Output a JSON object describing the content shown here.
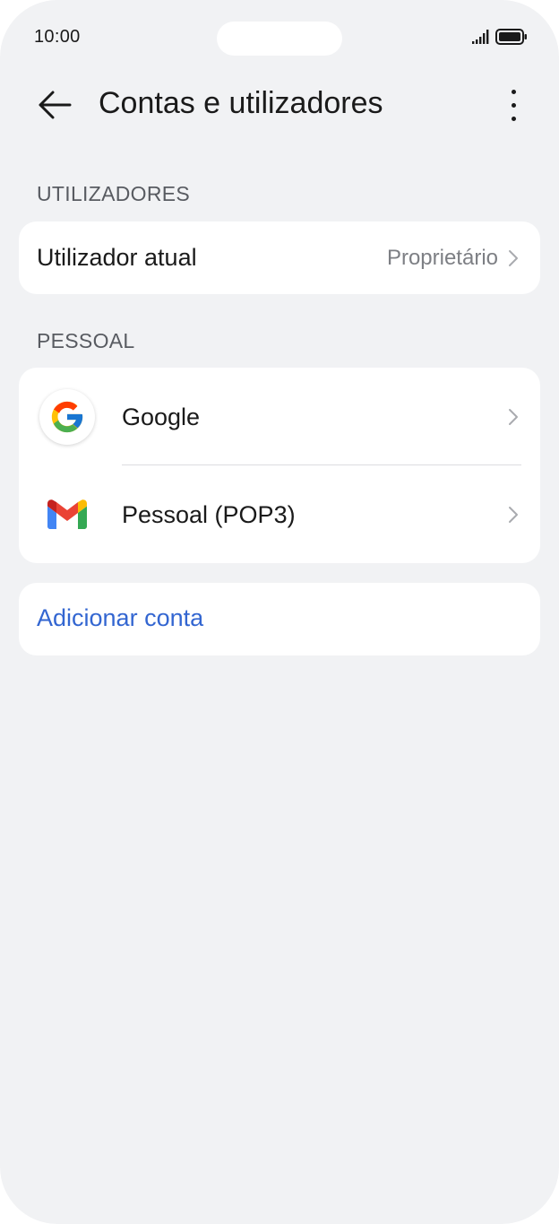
{
  "status_bar": {
    "time": "10:00",
    "signal_icon": "signal-bars-icon",
    "battery_icon": "battery-full-icon"
  },
  "header": {
    "title": "Contas e utilizadores",
    "back_icon": "arrow-left-icon",
    "more_icon": "more-vertical-icon"
  },
  "sections": {
    "users": {
      "title": "UTILIZADORES",
      "current_user": {
        "label": "Utilizador atual",
        "value": "Proprietário"
      }
    },
    "personal": {
      "title": "PESSOAL",
      "accounts": [
        {
          "label": "Google",
          "icon": "google-icon"
        },
        {
          "label": "Pessoal (POP3)",
          "icon": "gmail-icon"
        }
      ]
    }
  },
  "add_account": {
    "label": "Adicionar conta"
  },
  "colors": {
    "background": "#f1f2f4",
    "card": "#ffffff",
    "accent": "#3366d1",
    "text_primary": "#1a1a1a",
    "text_secondary": "#7d7f84"
  }
}
